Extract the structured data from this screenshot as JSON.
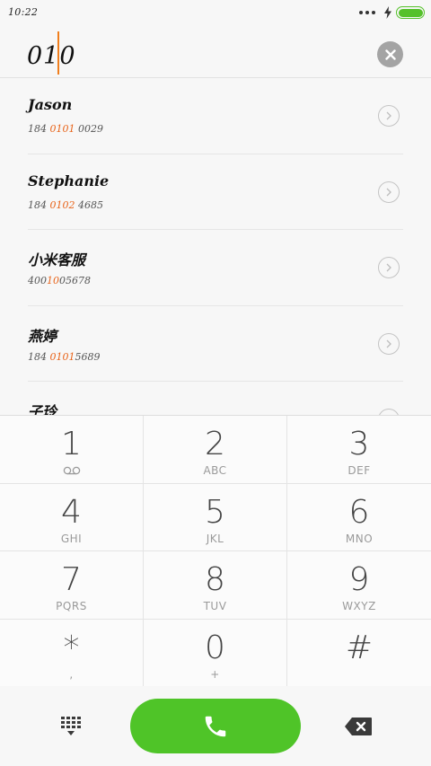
{
  "status_bar": {
    "time": "10:22",
    "battery_level": 1.0,
    "battery_color": "#55c12a"
  },
  "dialer": {
    "dialed_number": "010",
    "caret_color": "#f07e1d",
    "clear_icon": "close-icon"
  },
  "contacts": [
    {
      "name": "Jason",
      "number_prefix": "184 ",
      "number_match": "0101",
      "number_suffix": " 0029"
    },
    {
      "name": "Stephanie",
      "number_prefix": "184 ",
      "number_match": "0102",
      "number_suffix": " 4685"
    },
    {
      "name": "小米客服",
      "number_prefix": "400",
      "number_match": "10",
      "number_suffix": "05678"
    },
    {
      "name": "燕婷",
      "number_prefix": "184 ",
      "number_match": "0101",
      "number_suffix": "5689"
    },
    {
      "name": "子玲",
      "number_prefix": "",
      "number_match": "",
      "number_suffix": ""
    }
  ],
  "highlight_color": "#e8641a",
  "keypad": {
    "keys": [
      {
        "digit": "1",
        "letters": "",
        "sub_icon": "voicemail-icon"
      },
      {
        "digit": "2",
        "letters": "ABC"
      },
      {
        "digit": "3",
        "letters": "DEF"
      },
      {
        "digit": "4",
        "letters": "GHI"
      },
      {
        "digit": "5",
        "letters": "JKL"
      },
      {
        "digit": "6",
        "letters": "MNO"
      },
      {
        "digit": "7",
        "letters": "PQRS"
      },
      {
        "digit": "8",
        "letters": "TUV"
      },
      {
        "digit": "9",
        "letters": "WXYZ"
      },
      {
        "digit": "*",
        "letters": ","
      },
      {
        "digit": "0",
        "letters": "+"
      },
      {
        "digit": "#",
        "letters": ""
      }
    ]
  },
  "bottom_bar": {
    "dialpad_icon": "dialpad-icon",
    "call_icon": "phone-icon",
    "call_color": "#4fc428",
    "backspace_icon": "backspace-icon"
  }
}
